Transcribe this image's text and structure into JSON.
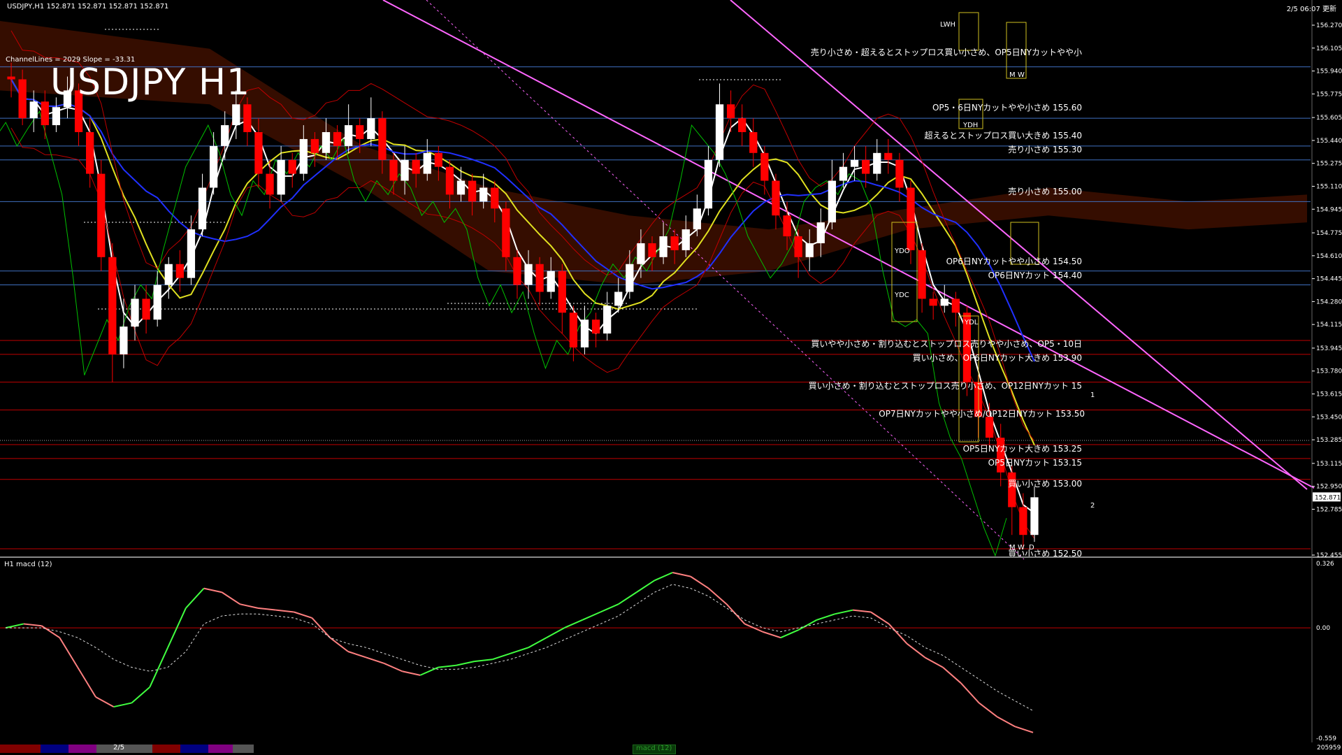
{
  "header": {
    "ohlc": "USDJPY,H1  152.871 152.871 152.871 152.871",
    "channel": "ChannelLines = 2029 Slope = -33.31",
    "title": "USDJPY H1",
    "timestamp": "2/5 06:07 更新"
  },
  "subwindow": {
    "label": "H1  macd (12)",
    "tab_label": "macd (12)"
  },
  "bottom": {
    "date_label": "2/5",
    "corner_value": "205959"
  },
  "price_axis": {
    "ticks": [
      "156.270",
      "156.105",
      "155.940",
      "155.775",
      "155.605",
      "155.440",
      "155.275",
      "155.110",
      "154.945",
      "154.775",
      "154.610",
      "154.445",
      "154.280",
      "154.115",
      "153.945",
      "153.780",
      "153.615",
      "153.450",
      "153.285",
      "153.115",
      "152.950",
      "152.785",
      "152.455"
    ],
    "current_price": "152.871"
  },
  "macd_axis": {
    "ticks": [
      "0.326",
      "0.00",
      "-0.559"
    ]
  },
  "annotations": [
    "売り小さめ・超えるとストップロス買い小さめ、OP5日NYカットやや小",
    "OP5・6日NYカットやや小さめ 155.60",
    "超えるとストップロス買い大きめ 155.40",
    "売り小さめ 155.30",
    "売り小さめ 155.00",
    "OP6日NYカットやや小さめ 154.50",
    "OP6日NYカット 154.40",
    "買いやや小さめ・割り込むとストップロス売りやや小さめ、OP5・10日",
    "買い小さめ、OP6日NYカット大きめ 153.90",
    "買い小さめ・割り込むとストップロス売り小さめ、OP12日NYカット 15",
    "OP7日NYカットやや小さめ/OP12日NYカット 153.50",
    "OP5日NYカット大きめ 153.25",
    "OP5日NYカット 153.15",
    "買い小さめ 153.00",
    "買い小さめ 152.50"
  ],
  "tags": [
    "LWH",
    "YDH",
    "YDO",
    "YDC",
    "YDL",
    "M",
    "W",
    "M",
    "W",
    "D",
    "1",
    "2"
  ],
  "colors": {
    "background": "#000000",
    "candle_up": "#ffffff",
    "candle_down": "#ff0000",
    "blue_line": "#3f6fbf",
    "red_line": "#c00000",
    "channel": "#ff66ff",
    "ma_white": "#ffffff",
    "ma_yellow": "#e0e020",
    "ma_blue": "#2030ff",
    "bollinger": "#c00000",
    "chikou": "#00c000",
    "cloud": "#c03000",
    "macd_up": "#40ff40",
    "macd_down": "#ff8080"
  },
  "chart_data": {
    "type": "line",
    "title": "USDJPY H1",
    "xlabel": "",
    "ylabel": "",
    "ylim": [
      152.455,
      156.27
    ],
    "grid": false,
    "current_price": 152.871,
    "levels": [
      {
        "price": 155.97,
        "color": "blue"
      },
      {
        "price": 155.6,
        "color": "blue"
      },
      {
        "price": 155.4,
        "color": "blue"
      },
      {
        "price": 155.3,
        "color": "blue"
      },
      {
        "price": 155.0,
        "color": "blue"
      },
      {
        "price": 154.5,
        "color": "blue"
      },
      {
        "price": 154.4,
        "color": "blue"
      },
      {
        "price": 154.0,
        "color": "red"
      },
      {
        "price": 153.9,
        "color": "red"
      },
      {
        "price": 153.7,
        "color": "red"
      },
      {
        "price": 153.5,
        "color": "red"
      },
      {
        "price": 153.25,
        "color": "red"
      },
      {
        "price": 153.15,
        "color": "red"
      },
      {
        "price": 153.0,
        "color": "red"
      },
      {
        "price": 152.5,
        "color": "red"
      }
    ],
    "candles": [
      [
        155.9,
        155.88,
        156.0,
        155.75
      ],
      [
        155.88,
        155.6,
        155.95,
        155.55
      ],
      [
        155.6,
        155.72,
        155.8,
        155.5
      ],
      [
        155.72,
        155.55,
        155.8,
        155.45
      ],
      [
        155.55,
        155.68,
        155.75,
        155.5
      ],
      [
        155.68,
        155.8,
        155.9,
        155.6
      ],
      [
        155.8,
        155.5,
        155.85,
        155.4
      ],
      [
        155.5,
        155.2,
        155.6,
        155.1
      ],
      [
        155.2,
        154.6,
        155.3,
        154.5
      ],
      [
        154.6,
        153.9,
        154.7,
        153.7
      ],
      [
        153.9,
        154.1,
        154.3,
        153.8
      ],
      [
        154.1,
        154.3,
        154.4,
        154.0
      ],
      [
        154.3,
        154.15,
        154.4,
        154.05
      ],
      [
        154.15,
        154.4,
        154.5,
        154.1
      ],
      [
        154.4,
        154.55,
        154.6,
        154.3
      ],
      [
        154.55,
        154.45,
        154.65,
        154.35
      ],
      [
        154.45,
        154.8,
        154.9,
        154.4
      ],
      [
        154.8,
        155.1,
        155.2,
        154.75
      ],
      [
        155.1,
        155.4,
        155.5,
        155.05
      ],
      [
        155.4,
        155.55,
        155.65,
        155.3
      ],
      [
        155.55,
        155.7,
        155.8,
        155.45
      ],
      [
        155.7,
        155.5,
        155.75,
        155.4
      ],
      [
        155.5,
        155.2,
        155.6,
        155.1
      ],
      [
        155.2,
        155.05,
        155.3,
        154.95
      ],
      [
        155.05,
        155.3,
        155.4,
        155.0
      ],
      [
        155.3,
        155.2,
        155.35,
        155.1
      ],
      [
        155.2,
        155.45,
        155.55,
        155.15
      ],
      [
        155.45,
        155.35,
        155.5,
        155.25
      ],
      [
        155.35,
        155.5,
        155.6,
        155.3
      ],
      [
        155.5,
        155.4,
        155.55,
        155.3
      ],
      [
        155.4,
        155.55,
        155.7,
        155.35
      ],
      [
        155.55,
        155.45,
        155.6,
        155.35
      ],
      [
        155.45,
        155.6,
        155.75,
        155.4
      ],
      [
        155.6,
        155.3,
        155.65,
        155.2
      ],
      [
        155.3,
        155.15,
        155.35,
        155.05
      ],
      [
        155.15,
        155.3,
        155.4,
        155.05
      ],
      [
        155.3,
        155.2,
        155.35,
        155.1
      ],
      [
        155.2,
        155.35,
        155.45,
        155.15
      ],
      [
        155.35,
        155.25,
        155.4,
        155.15
      ],
      [
        155.25,
        155.05,
        155.3,
        154.95
      ],
      [
        155.05,
        155.15,
        155.25,
        155.0
      ],
      [
        155.15,
        155.0,
        155.2,
        154.9
      ],
      [
        155.0,
        155.1,
        155.2,
        154.95
      ],
      [
        155.1,
        154.95,
        155.15,
        154.85
      ],
      [
        154.95,
        154.6,
        155.0,
        154.5
      ],
      [
        154.6,
        154.4,
        154.65,
        154.3
      ],
      [
        154.4,
        154.55,
        154.65,
        154.3
      ],
      [
        154.55,
        154.35,
        154.6,
        154.25
      ],
      [
        154.35,
        154.5,
        154.6,
        154.3
      ],
      [
        154.5,
        154.2,
        154.55,
        154.05
      ],
      [
        154.2,
        153.95,
        154.25,
        153.85
      ],
      [
        153.95,
        154.15,
        154.25,
        153.9
      ],
      [
        154.15,
        154.05,
        154.2,
        153.95
      ],
      [
        154.05,
        154.25,
        154.35,
        154.0
      ],
      [
        154.25,
        154.35,
        154.45,
        154.2
      ],
      [
        154.35,
        154.55,
        154.65,
        154.3
      ],
      [
        154.55,
        154.7,
        154.8,
        154.45
      ],
      [
        154.7,
        154.6,
        154.75,
        154.5
      ],
      [
        154.6,
        154.75,
        154.85,
        154.55
      ],
      [
        154.75,
        154.65,
        154.8,
        154.55
      ],
      [
        154.65,
        154.8,
        154.9,
        154.6
      ],
      [
        154.8,
        154.95,
        155.05,
        154.75
      ],
      [
        154.95,
        155.3,
        155.4,
        154.9
      ],
      [
        155.3,
        155.7,
        155.85,
        155.25
      ],
      [
        155.7,
        155.6,
        155.8,
        155.5
      ],
      [
        155.6,
        155.5,
        155.7,
        155.4
      ],
      [
        155.5,
        155.35,
        155.6,
        155.25
      ],
      [
        155.35,
        155.15,
        155.4,
        155.05
      ],
      [
        155.15,
        154.9,
        155.2,
        154.8
      ],
      [
        154.9,
        154.75,
        155.0,
        154.65
      ],
      [
        154.75,
        154.6,
        154.8,
        154.45
      ],
      [
        154.6,
        154.7,
        154.8,
        154.5
      ],
      [
        154.7,
        154.85,
        154.95,
        154.6
      ],
      [
        154.85,
        155.15,
        155.3,
        154.8
      ],
      [
        155.15,
        155.25,
        155.35,
        155.1
      ],
      [
        155.25,
        155.3,
        155.4,
        155.15
      ],
      [
        155.3,
        155.2,
        155.4,
        155.1
      ],
      [
        155.2,
        155.35,
        155.45,
        155.15
      ],
      [
        155.35,
        155.3,
        155.45,
        155.2
      ],
      [
        155.3,
        155.1,
        155.35,
        155.0
      ],
      [
        155.1,
        154.65,
        155.15,
        154.55
      ],
      [
        154.65,
        154.3,
        154.7,
        154.2
      ],
      [
        154.3,
        154.25,
        154.35,
        154.15
      ],
      [
        154.25,
        154.3,
        154.4,
        154.2
      ],
      [
        154.3,
        154.2,
        154.35,
        154.1
      ],
      [
        154.2,
        153.7,
        154.25,
        153.6
      ],
      [
        153.7,
        153.45,
        153.75,
        153.3
      ],
      [
        153.45,
        153.3,
        153.55,
        153.2
      ],
      [
        153.3,
        153.05,
        153.4,
        152.95
      ],
      [
        153.05,
        152.8,
        153.1,
        152.6
      ],
      [
        152.8,
        152.6,
        152.9,
        152.5
      ],
      [
        152.6,
        152.871,
        152.95,
        152.55
      ]
    ],
    "macd": {
      "ylim": [
        -0.559,
        0.326
      ],
      "main": [
        0.0,
        0.02,
        0.01,
        -0.05,
        -0.2,
        -0.35,
        -0.4,
        -0.38,
        -0.3,
        -0.1,
        0.1,
        0.2,
        0.18,
        0.12,
        0.1,
        0.09,
        0.08,
        0.05,
        -0.05,
        -0.12,
        -0.15,
        -0.18,
        -0.22,
        -0.24,
        -0.2,
        -0.19,
        -0.17,
        -0.16,
        -0.13,
        -0.1,
        -0.05,
        0.0,
        0.04,
        0.08,
        0.12,
        0.18,
        0.24,
        0.28,
        0.26,
        0.2,
        0.12,
        0.02,
        -0.02,
        -0.05,
        -0.01,
        0.04,
        0.07,
        0.09,
        0.08,
        0.02,
        -0.08,
        -0.15,
        -0.2,
        -0.28,
        -0.38,
        -0.45,
        -0.5,
        -0.53
      ],
      "signal": [
        0.0,
        0.0,
        0.0,
        -0.02,
        -0.05,
        -0.1,
        -0.16,
        -0.2,
        -0.22,
        -0.2,
        -0.12,
        0.02,
        0.06,
        0.07,
        0.07,
        0.06,
        0.05,
        0.02,
        -0.05,
        -0.08,
        -0.1,
        -0.13,
        -0.16,
        -0.19,
        -0.21,
        -0.21,
        -0.2,
        -0.18,
        -0.16,
        -0.13,
        -0.1,
        -0.06,
        -0.02,
        0.02,
        0.06,
        0.12,
        0.18,
        0.22,
        0.2,
        0.16,
        0.1,
        0.04,
        0.0,
        -0.02,
        0.0,
        0.02,
        0.04,
        0.06,
        0.05,
        0.0,
        -0.04,
        -0.1,
        -0.14,
        -0.2,
        -0.26,
        -0.32,
        -0.37,
        -0.42
      ]
    }
  }
}
